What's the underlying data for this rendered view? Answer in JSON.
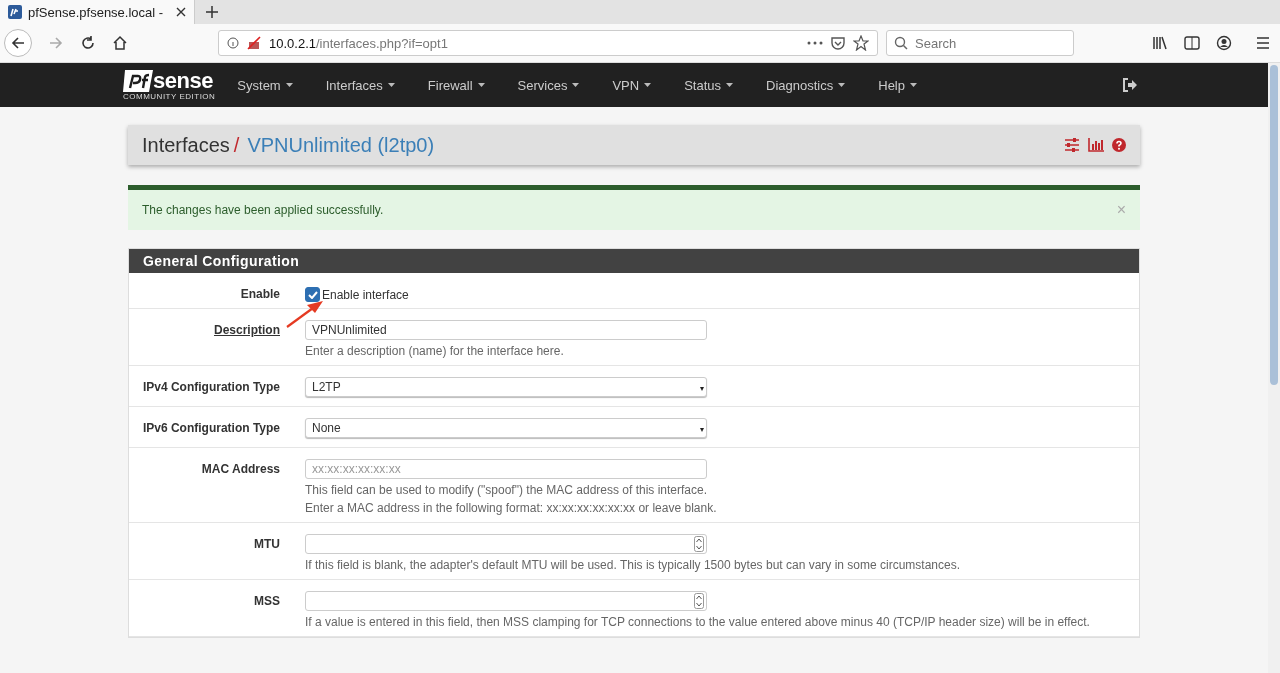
{
  "browser": {
    "tab_title": "pfSense.pfsense.local -",
    "url_host": "10.0.2.1",
    "url_path": "/interfaces.php?if=opt1",
    "search": {
      "placeholder": "Search"
    }
  },
  "navbar": {
    "logo": "sense",
    "logo_sub": "COMMUNITY EDITION",
    "menu": [
      "System",
      "Interfaces",
      "Firewall",
      "Services",
      "VPN",
      "Status",
      "Diagnostics",
      "Help"
    ]
  },
  "breadcrumb": {
    "section": "Interfaces",
    "separator": "/",
    "current": "VPNUnlimited (l2tp0)"
  },
  "alert": {
    "message": "The changes have been applied successfully.",
    "close": "×"
  },
  "panel": {
    "title": "General Configuration",
    "rows": [
      {
        "kind": "checkbox",
        "label": "Enable",
        "checked": true,
        "text": "Enable interface",
        "annotated": true
      },
      {
        "kind": "text",
        "label": "Description",
        "underlined": true,
        "value": "VPNUnlimited",
        "help": [
          "Enter a description (name) for the interface here."
        ]
      },
      {
        "kind": "select",
        "label": "IPv4 Configuration Type",
        "value": "L2TP"
      },
      {
        "kind": "select",
        "label": "IPv6 Configuration Type",
        "value": "None"
      },
      {
        "kind": "text",
        "label": "MAC Address",
        "placeholder": "xx:xx:xx:xx:xx:xx",
        "help": [
          "This field can be used to modify (\"spoof\") the MAC address of this interface.",
          "Enter a MAC address in the following format: xx:xx:xx:xx:xx:xx or leave blank."
        ]
      },
      {
        "kind": "number",
        "label": "MTU",
        "help": [
          "If this field is blank, the adapter's default MTU will be used. This is typically 1500 bytes but can vary in some circumstances."
        ]
      },
      {
        "kind": "number",
        "label": "MSS",
        "help": [
          "If a value is entered in this field, then MSS clamping for TCP connections to the value entered above minus 40 (TCP/IP header size) will be in effect."
        ]
      }
    ]
  }
}
